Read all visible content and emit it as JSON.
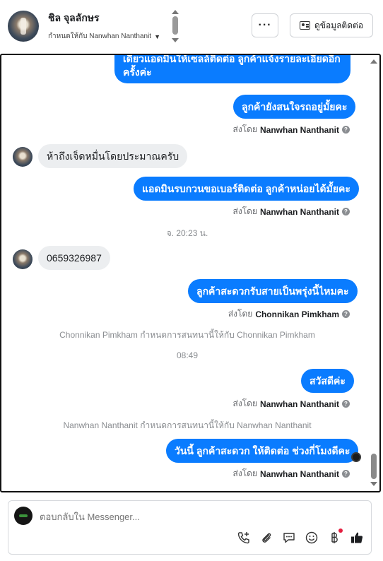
{
  "header": {
    "contact_name": "ชิล จุลลักษร",
    "assigned_to": "กำหนดให้กับ Nanwhan Nanthanit",
    "more_label": "···",
    "contact_details_label": "ดูข้อมูลติดต่อ"
  },
  "messages": [
    {
      "type": "out",
      "text_line1": "เดี๋ยวแอดมินให้เซลล์ติดต่อ ลูกค้าแจ้งรายละเอียดอีก",
      "text_line2": "ครั้งค่ะ"
    },
    {
      "type": "out",
      "text": "ลูกค้ายังสนใจรถอยู่มั้ยคะ",
      "sent_by_prefix": "ส่งโดย",
      "sent_by": "Nanwhan Nanthanit"
    },
    {
      "type": "in",
      "text": "ห้าถึงเจ็ดหมื่นโดยประมาณครับ"
    },
    {
      "type": "out",
      "text": "แอดมินรบกวนขอเบอร์ติดต่อ ลูกค้าหน่อยได้มั้ยคะ",
      "sent_by_prefix": "ส่งโดย",
      "sent_by": "Nanwhan Nanthanit"
    },
    {
      "type": "time",
      "text": "จ. 20:23 น."
    },
    {
      "type": "in",
      "text": "0659326987"
    },
    {
      "type": "out",
      "text": "ลูกค้าสะดวกรับสายเป็นพรุ่งนี้ไหมคะ",
      "sent_by_prefix": "ส่งโดย",
      "sent_by": "Chonnikan Pimkham"
    },
    {
      "type": "system",
      "text": "Chonnikan Pimkham กำหนดการสนทนานี้ให้กับ Chonnikan Pimkham"
    },
    {
      "type": "time",
      "text": "08:49"
    },
    {
      "type": "out",
      "text": "สวัสดีค่ะ",
      "sent_by_prefix": "ส่งโดย",
      "sent_by": "Nanwhan Nanthanit"
    },
    {
      "type": "system",
      "text": "Nanwhan Nanthanit กำหนดการสนทนานี้ให้กับ Nanwhan Nanthanit"
    },
    {
      "type": "out",
      "text": "วันนี้ ลูกค้าสะดวก ให้ติดต่อ ช่วงกี่โมงดีคะ",
      "sent_by_prefix": "ส่งโดย",
      "sent_by": "Nanwhan Nanthanit"
    }
  ],
  "composer": {
    "placeholder": "ตอบกลับใน Messenger..."
  },
  "icons": {
    "call": "phone-plus-icon",
    "attach": "paperclip-icon",
    "saved_replies": "chat-bubble-icon",
    "emoji": "smiley-icon",
    "payment": "baht-icon",
    "like": "thumbs-up-icon"
  },
  "colors": {
    "outgoing_bubble": "#0a7cff",
    "incoming_bubble": "#eceef0",
    "notification_dot": "#e41e3f"
  }
}
